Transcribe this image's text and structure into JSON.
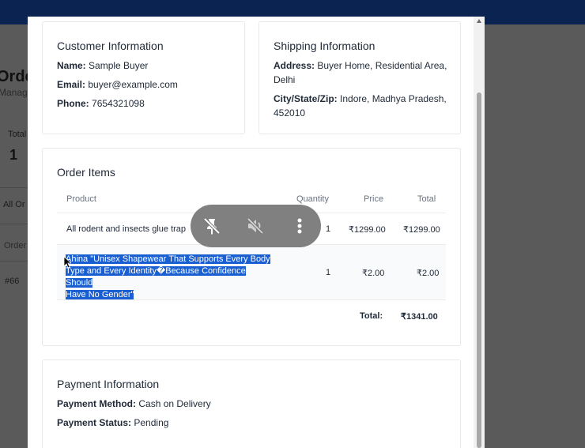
{
  "background": {
    "page_title": "Orde",
    "page_subtitle": "Manage",
    "total_label": "Total",
    "total_value": "1",
    "all_orders_tab": "All Or",
    "order_column": "Order",
    "order_id": "#66"
  },
  "customer": {
    "title": "Customer Information",
    "name_label": "Name:",
    "name": "Sample Buyer",
    "email_label": "Email:",
    "email": "buyer@example.com",
    "phone_label": "Phone:",
    "phone": "7654321098"
  },
  "shipping": {
    "title": "Shipping Information",
    "address_label": "Address:",
    "address_line1": "Buyer Home, Residential Area,",
    "address_line2": "Delhi",
    "city_label": "City/State/Zip:",
    "city_line1": "Indore, Madhya Pradesh,",
    "city_line2": "452010"
  },
  "order_items": {
    "title": "Order Items",
    "columns": {
      "product": "Product",
      "quantity": "Quantity",
      "price": "Price",
      "total": "Total"
    },
    "rows": [
      {
        "product": "All rodent and insects glue trap",
        "quantity": "1",
        "price": "₹1299.00",
        "total": "₹1299.00"
      },
      {
        "product_line1": "Ahina \"Unisex Shapewear That Supports Every Body",
        "product_line2": "Type and Every Identity�Because Confidence Should",
        "product_line3": "Have No Gender\"",
        "quantity": "1",
        "price": "₹2.00",
        "total": "₹2.00"
      }
    ],
    "total_label": "Total:",
    "total_value": "₹1341.00"
  },
  "payment": {
    "title": "Payment Information",
    "method_label": "Payment Method:",
    "method": "Cash on Delivery",
    "status_label": "Payment Status:",
    "status": "Pending"
  },
  "overlay_controls": {
    "icons": [
      "unpin-icon",
      "mute-icon",
      "more-vertical-icon"
    ]
  }
}
